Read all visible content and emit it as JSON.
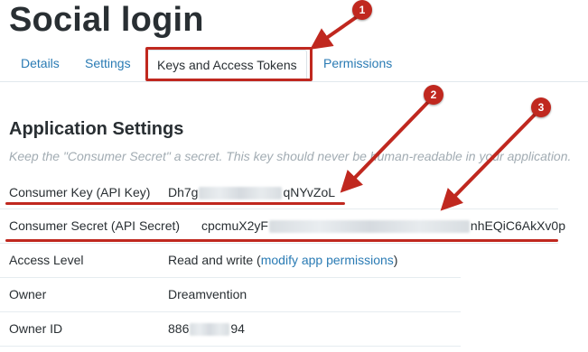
{
  "app": {
    "title": "Social login"
  },
  "tabs": [
    {
      "label": "Details"
    },
    {
      "label": "Settings"
    },
    {
      "label": "Keys and Access Tokens",
      "active": true
    },
    {
      "label": "Permissions"
    }
  ],
  "section": {
    "title": "Application Settings",
    "note": "Keep the \"Consumer Secret\" a secret. This key should never be human-readable in your application."
  },
  "fields": {
    "consumer_key": {
      "label": "Consumer Key (API Key)",
      "value_start": "Dh7g",
      "value_end": "qNYvZoL"
    },
    "consumer_secret": {
      "label": "Consumer Secret (API Secret)",
      "value_start": "cpcmuX2yF",
      "value_end": "nhEQiC6AkXv0p"
    },
    "access_level": {
      "label": "Access Level",
      "value_prefix": "Read and write (",
      "link": "modify app permissions",
      "value_suffix": ")"
    },
    "owner": {
      "label": "Owner",
      "value": "Dreamvention"
    },
    "owner_id": {
      "label": "Owner ID",
      "value_start": "886",
      "value_end": "94"
    }
  },
  "annotations": {
    "color": "#c0281f",
    "badges": [
      "1",
      "2",
      "3"
    ]
  },
  "colors": {
    "link": "#2a7bb4",
    "text": "#292f33",
    "muted": "#a2acb3"
  }
}
